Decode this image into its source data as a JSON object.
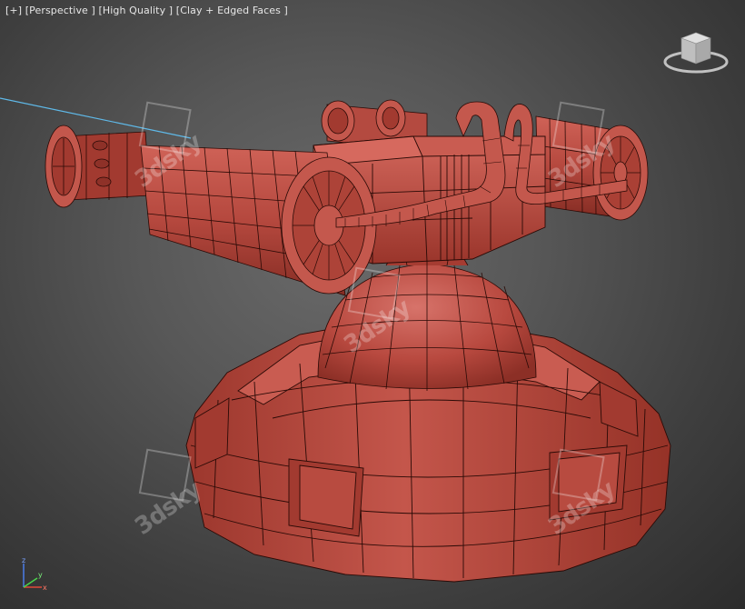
{
  "viewport": {
    "label_parts": [
      "[+]",
      "[Perspective ]",
      "[High Quality ]",
      "[Clay + Edged Faces ]"
    ]
  },
  "watermark": {
    "text": "3dsky"
  },
  "axis": {
    "x": "x",
    "y": "y",
    "z": "z"
  },
  "icons": {
    "viewcube": "viewcube-icon",
    "axis": "axis-tripod-icon"
  },
  "colors": {
    "clay": "#b5483e",
    "clay_dark": "#8e3128",
    "clay_light": "#cf6257",
    "wire": "#2a0a06",
    "selection_line": "#5fb9e8",
    "axis_x": "#e04a3a",
    "axis_y": "#49d84a",
    "axis_z": "#4a7de8"
  }
}
